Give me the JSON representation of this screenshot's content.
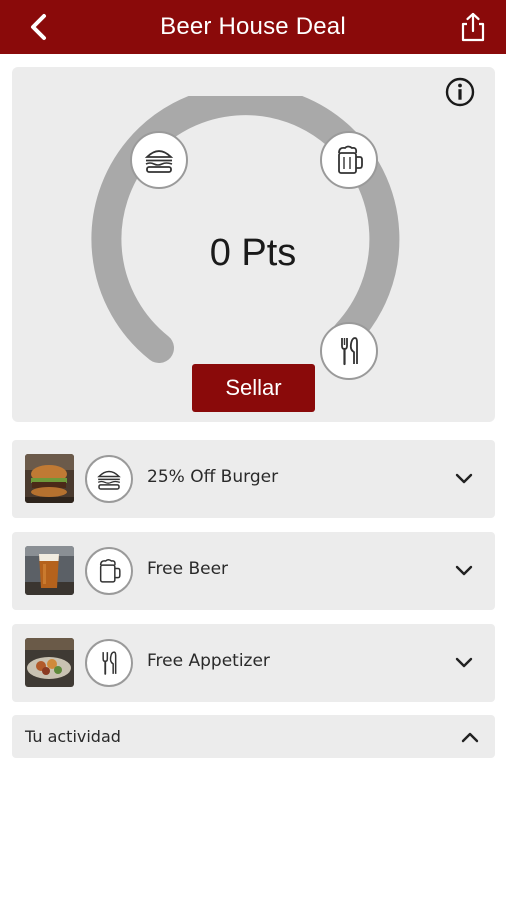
{
  "header": {
    "title": "Beer House Deal",
    "back_icon": "chevron-left-icon",
    "share_icon": "share-icon"
  },
  "card": {
    "points_label": "0 Pts",
    "stamp_button": "Sellar",
    "info_icon": "info-icon",
    "progress_fraction": 0
  },
  "rewards": [
    {
      "label": "25% Off Burger",
      "icon": "burger-icon",
      "image": "burger-photo"
    },
    {
      "label": "Free Beer",
      "icon": "beer-mug-icon",
      "image": "beer-photo"
    },
    {
      "label": "Free Appetizer",
      "icon": "cutlery-icon",
      "image": "appetizer-photo"
    }
  ],
  "activity": {
    "label": "Tu actividad",
    "state": "expanded"
  },
  "colors": {
    "brand": "#8a0a0a",
    "card_bg": "#ececec",
    "gauge_track": "#a9a9a9"
  }
}
